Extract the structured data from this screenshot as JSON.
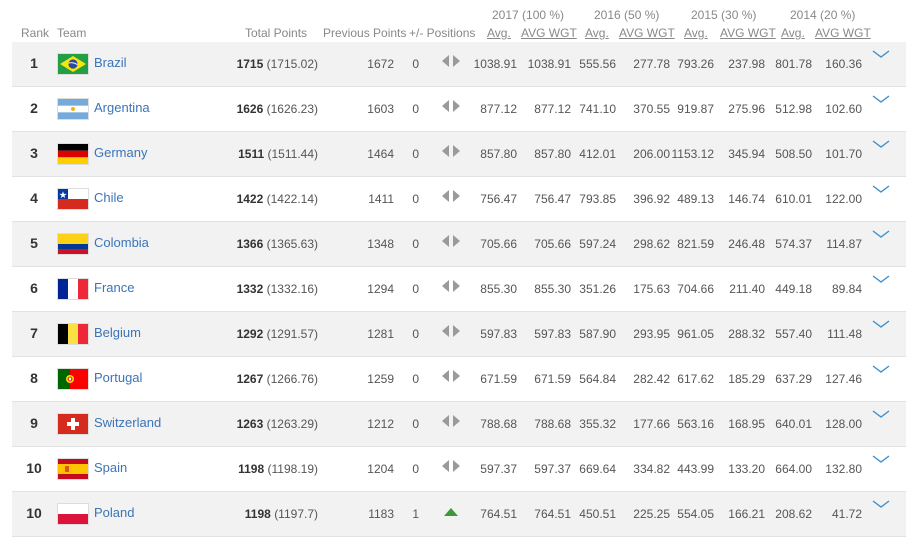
{
  "header": {
    "years": {
      "y2017": "2017 (100 %)",
      "y2016": "2016 (50 %)",
      "y2015": "2015 (30 %)",
      "y2014": "2014 (20 %)"
    },
    "columns": {
      "rank": "Rank",
      "team": "Team",
      "total_points": "Total Points",
      "previous_points": "Previous Points",
      "positions": "+/- Positions",
      "avg": "Avg.",
      "avg_wgt": "AVG WGT"
    }
  },
  "rows": [
    {
      "rank": "1",
      "team": "Brazil",
      "flag": "brazil",
      "total": "1715",
      "total_exact": "(1715.02)",
      "prev": "1672",
      "change": "0",
      "pos_icon": "no-change-icon",
      "a17": "1038.91",
      "w17": "1038.91",
      "a16": "555.56",
      "w16": "277.78",
      "a15": "793.26",
      "w15": "237.98",
      "a14": "801.78",
      "w14": "160.36"
    },
    {
      "rank": "2",
      "team": "Argentina",
      "flag": "argentina",
      "total": "1626",
      "total_exact": "(1626.23)",
      "prev": "1603",
      "change": "0",
      "pos_icon": "no-change-icon",
      "a17": "877.12",
      "w17": "877.12",
      "a16": "741.10",
      "w16": "370.55",
      "a15": "919.87",
      "w15": "275.96",
      "a14": "512.98",
      "w14": "102.60"
    },
    {
      "rank": "3",
      "team": "Germany",
      "flag": "germany",
      "total": "1511",
      "total_exact": "(1511.44)",
      "prev": "1464",
      "change": "0",
      "pos_icon": "no-change-icon",
      "a17": "857.80",
      "w17": "857.80",
      "a16": "412.01",
      "w16": "206.00",
      "a15": "1153.12",
      "w15": "345.94",
      "a14": "508.50",
      "w14": "101.70"
    },
    {
      "rank": "4",
      "team": "Chile",
      "flag": "chile",
      "total": "1422",
      "total_exact": "(1422.14)",
      "prev": "1411",
      "change": "0",
      "pos_icon": "no-change-icon",
      "a17": "756.47",
      "w17": "756.47",
      "a16": "793.85",
      "w16": "396.92",
      "a15": "489.13",
      "w15": "146.74",
      "a14": "610.01",
      "w14": "122.00"
    },
    {
      "rank": "5",
      "team": "Colombia",
      "flag": "colombia",
      "total": "1366",
      "total_exact": "(1365.63)",
      "prev": "1348",
      "change": "0",
      "pos_icon": "no-change-icon",
      "a17": "705.66",
      "w17": "705.66",
      "a16": "597.24",
      "w16": "298.62",
      "a15": "821.59",
      "w15": "246.48",
      "a14": "574.37",
      "w14": "114.87"
    },
    {
      "rank": "6",
      "team": "France",
      "flag": "france",
      "total": "1332",
      "total_exact": "(1332.16)",
      "prev": "1294",
      "change": "0",
      "pos_icon": "no-change-icon",
      "a17": "855.30",
      "w17": "855.30",
      "a16": "351.26",
      "w16": "175.63",
      "a15": "704.66",
      "w15": "211.40",
      "a14": "449.18",
      "w14": "89.84"
    },
    {
      "rank": "7",
      "team": "Belgium",
      "flag": "belgium",
      "total": "1292",
      "total_exact": "(1291.57)",
      "prev": "1281",
      "change": "0",
      "pos_icon": "no-change-icon",
      "a17": "597.83",
      "w17": "597.83",
      "a16": "587.90",
      "w16": "293.95",
      "a15": "961.05",
      "w15": "288.32",
      "a14": "557.40",
      "w14": "111.48"
    },
    {
      "rank": "8",
      "team": "Portugal",
      "flag": "portugal",
      "total": "1267",
      "total_exact": "(1266.76)",
      "prev": "1259",
      "change": "0",
      "pos_icon": "no-change-icon",
      "a17": "671.59",
      "w17": "671.59",
      "a16": "564.84",
      "w16": "282.42",
      "a15": "617.62",
      "w15": "185.29",
      "a14": "637.29",
      "w14": "127.46"
    },
    {
      "rank": "9",
      "team": "Switzerland",
      "flag": "switzerland",
      "total": "1263",
      "total_exact": "(1263.29)",
      "prev": "1212",
      "change": "0",
      "pos_icon": "no-change-icon",
      "a17": "788.68",
      "w17": "788.68",
      "a16": "355.32",
      "w16": "177.66",
      "a15": "563.16",
      "w15": "168.95",
      "a14": "640.01",
      "w14": "128.00"
    },
    {
      "rank": "10",
      "team": "Spain",
      "flag": "spain",
      "total": "1198",
      "total_exact": "(1198.19)",
      "prev": "1204",
      "change": "0",
      "pos_icon": "no-change-icon",
      "a17": "597.37",
      "w17": "597.37",
      "a16": "669.64",
      "w16": "334.82",
      "a15": "443.99",
      "w15": "133.20",
      "a14": "664.00",
      "w14": "132.80"
    },
    {
      "rank": "10",
      "team": "Poland",
      "flag": "poland",
      "total": "1198",
      "total_exact": "(1197.7)",
      "prev": "1183",
      "change": "1",
      "pos_icon": "up-arrow-icon",
      "a17": "764.51",
      "w17": "764.51",
      "a16": "450.51",
      "w16": "225.25",
      "a15": "554.05",
      "w15": "166.21",
      "a14": "208.62",
      "w14": "41.72"
    }
  ],
  "colors": {
    "team_link": "#3b74b8",
    "row_shade": "#f2f2f2",
    "up_arrow": "#3a9a3a",
    "no_change": "#9a9a9a",
    "chevron": "#3b8fd0"
  }
}
